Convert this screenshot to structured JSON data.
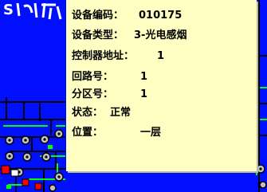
{
  "colors": {
    "background": "#0010ff",
    "popup": "#ffffc4",
    "popup_text": "#000000",
    "wall": "#000000",
    "highlight": "#00ff00",
    "device": "#c0c0c0",
    "alarm": "#ff0000"
  },
  "fragments": {
    "title_partial": "S"
  },
  "device_info": {
    "code_label": "设备编码：",
    "code_value": "010175",
    "type_label": "设备类型：",
    "type_value": "3-光电感烟",
    "controller_label": "控制器地址：",
    "controller_value": "1",
    "loop_label": "回路号：",
    "loop_value": "1",
    "zone_label": "分区号：",
    "zone_value": "1",
    "status_label": "状态：",
    "status_value": "正常",
    "location_label": "位置：",
    "location_value": "一层"
  }
}
